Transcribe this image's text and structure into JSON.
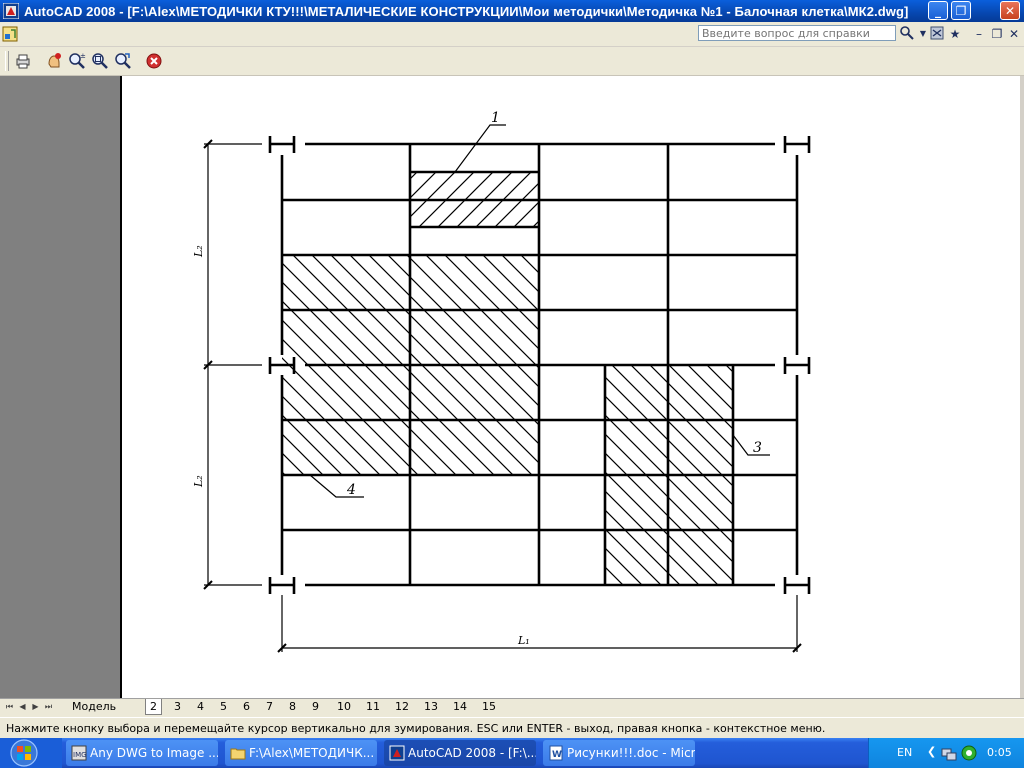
{
  "window": {
    "title": "AutoCAD 2008 - [F:\\Alex\\МЕТОДИЧКИ КТУ!!!\\МЕТАЛИЧЕСКИЕ КОНСТРУКЦИИ\\Мои методички\\Методичка №1 - Балочная клетка\\МК2.dwg]",
    "icon": "autocad-app-icon",
    "buttons": {
      "minimize": "_",
      "restore": "❐",
      "close": "✕"
    }
  },
  "menubar": {
    "help_placeholder": "Введите вопрос для справки",
    "icons": [
      "search-icon",
      "communication-center-icon",
      "favorites-star-icon"
    ],
    "doc_controls": {
      "minimize": "–",
      "restore": "❐",
      "close": "✕"
    }
  },
  "toolbar": {
    "tools": [
      "plot-icon",
      "pan-icon",
      "zoom-realtime-icon",
      "zoom-window-icon",
      "zoom-previous-icon",
      "close-preview-icon"
    ]
  },
  "drawing": {
    "labels": {
      "top_left_dimension": "L₂",
      "bottom_left_dimension": "L₂",
      "bottom_dimension": "L₁",
      "callout_1": "1",
      "callout_3": "3",
      "callout_4": "4"
    }
  },
  "tabs": {
    "nav": [
      "⏮",
      "◀",
      "▶",
      "⏭"
    ],
    "items": [
      "Модель",
      "2",
      "3",
      "4",
      "5",
      "6",
      "7",
      "8",
      "9",
      "10",
      "11",
      "12",
      "13",
      "14",
      "15"
    ],
    "active": "2"
  },
  "status": {
    "message": "Нажмите кнопку выбора и перемещайте курсор вертикально для зумирования. ESC или ENTER - выход, правая кнопка - контекстное меню."
  },
  "taskbar": {
    "items": [
      {
        "label": "Any DWG to Image ...",
        "icon": "dwg-converter-icon"
      },
      {
        "label": "F:\\Alex\\МЕТОДИЧК...",
        "icon": "folder-icon"
      },
      {
        "label": "AutoCAD 2008 - [F:\\...",
        "icon": "autocad-icon",
        "active": true
      },
      {
        "label": "Рисунки!!!.doc - Micr...",
        "icon": "word-doc-icon"
      }
    ],
    "tray": {
      "language": "EN",
      "clock": "0:05"
    }
  }
}
